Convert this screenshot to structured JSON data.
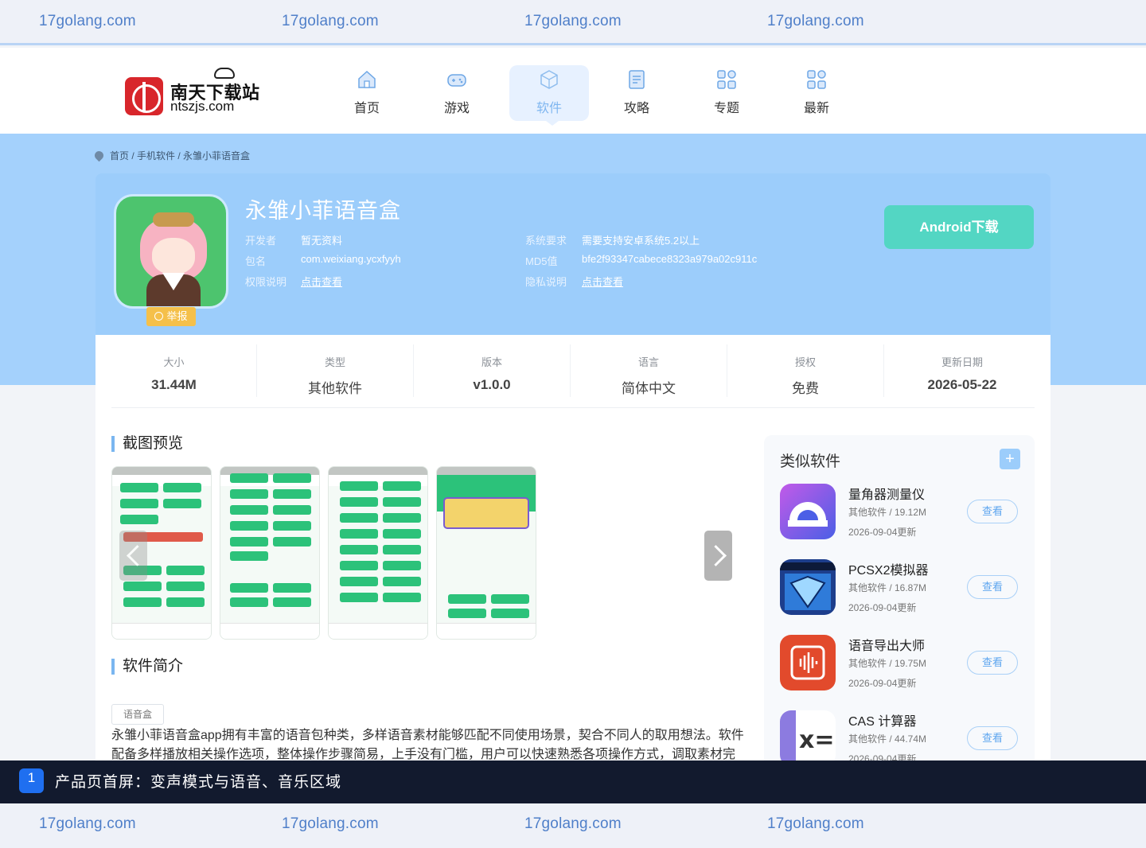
{
  "watermark": {
    "text": "17golang.com"
  },
  "logo": {
    "cn": "南天下载站",
    "en": "ntszjs.com"
  },
  "nav": [
    {
      "label": "首页",
      "icon": "home-icon"
    },
    {
      "label": "游戏",
      "icon": "gamepad-icon"
    },
    {
      "label": "软件",
      "icon": "cube-icon",
      "active": true
    },
    {
      "label": "攻略",
      "icon": "document-icon"
    },
    {
      "label": "专题",
      "icon": "grid-icon"
    },
    {
      "label": "最新",
      "icon": "grid-icon"
    }
  ],
  "breadcrumb": {
    "text": "首页 / 手机软件 /  永雏小菲语音盒"
  },
  "app": {
    "title": "永雏小菲语音盒",
    "report": "举报",
    "developer_label": "开发者",
    "developer": "暂无资料",
    "package_label": "包名",
    "package": "com.weixiang.ycxfyyh",
    "permission_label": "权限说明",
    "permission": "点击查看",
    "requirement_label": "系统要求",
    "requirement": "需要支持安卓系统5.2以上",
    "md5_label": "MD5值",
    "md5": "bfe2f93347cabece8323a979a02c911c",
    "privacy_label": "隐私说明",
    "privacy": "点击查看",
    "download": "Android下载"
  },
  "stats": [
    {
      "label": "大小",
      "value": "31.44M"
    },
    {
      "label": "类型",
      "value": "其他软件"
    },
    {
      "label": "版本",
      "value": "v1.0.0"
    },
    {
      "label": "语言",
      "value": "简体中文"
    },
    {
      "label": "授权",
      "value": "免费"
    },
    {
      "label": "更新日期",
      "value": "2026-05-22"
    }
  ],
  "sections": {
    "screenshots": "截图预览",
    "intro": "软件简介",
    "tag": "语音盒",
    "description": "永雏小菲语音盒app拥有丰富的语音包种类，多样语音素材能够匹配不同使用场景，契合不同人的取用想法。软件配备多样播放相关操作选项，整体操作步骤简易，上手没有门槛，用户可以快速熟悉各项操作方式，调取素材完"
  },
  "similar": {
    "title": "类似软件",
    "plus": "+",
    "items": [
      {
        "name": "量角器测量仪",
        "meta": "其他软件 / 19.12M",
        "date": "2026-09-04更新",
        "button": "查看",
        "icon": "protractor-icon"
      },
      {
        "name": "PCSX2模拟器",
        "meta": "其他软件 / 16.87M",
        "date": "2026-09-04更新",
        "button": "查看",
        "icon": "pcsx2-icon"
      },
      {
        "name": "语音导出大师",
        "meta": "其他软件 / 19.75M",
        "date": "2026-09-04更新",
        "button": "查看",
        "icon": "voice-export-icon"
      },
      {
        "name": "CAS 计算器",
        "meta": "其他软件 / 44.74M",
        "date": "2026-09-04更新",
        "button": "查看",
        "icon": "calculator-icon"
      }
    ]
  },
  "caption": {
    "number": "1",
    "text": "产品页首屏：变声模式与语音、音乐区域"
  }
}
